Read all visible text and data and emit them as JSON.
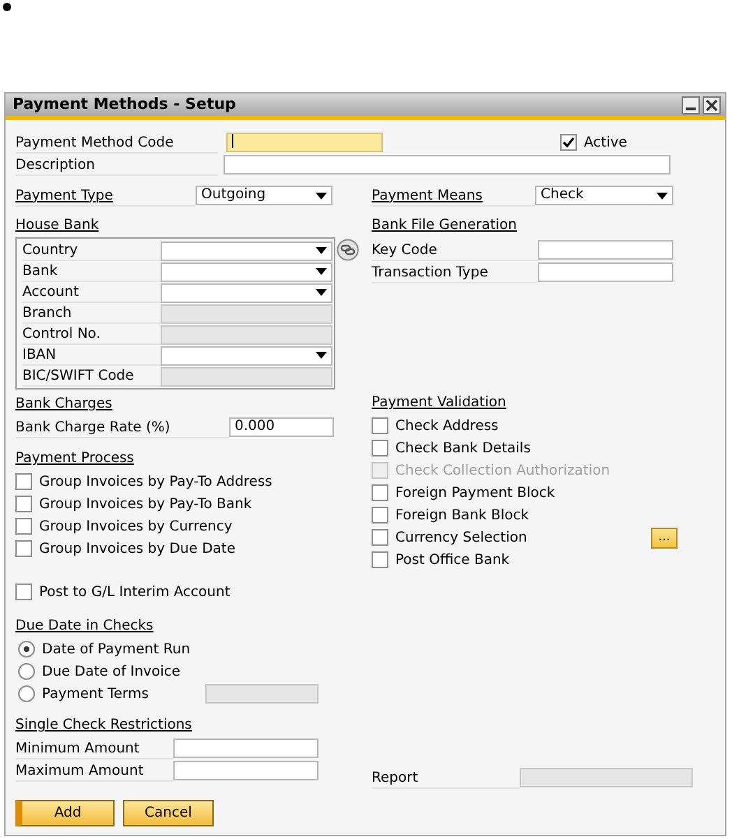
{
  "window": {
    "title": "Payment Methods - Setup"
  },
  "header_fields": [
    {
      "label": "Payment Method Code",
      "focused": true
    },
    {
      "label": "Description",
      "focused": false
    }
  ],
  "active": {
    "label": "Active",
    "checked": true
  },
  "payment_type": {
    "label": "Payment Type",
    "value": "Outgoing"
  },
  "payment_means": {
    "label": "Payment Means",
    "value": "Check"
  },
  "house_bank": {
    "title": "House Bank",
    "fields": [
      {
        "label": "Country",
        "kind": "dropdown"
      },
      {
        "label": "Bank",
        "kind": "dropdown"
      },
      {
        "label": "Account",
        "kind": "dropdown"
      },
      {
        "label": "Branch",
        "kind": "readonly"
      },
      {
        "label": "Control No.",
        "kind": "readonly"
      },
      {
        "label": "IBAN",
        "kind": "dropdown"
      },
      {
        "label": "BIC/SWIFT Code",
        "kind": "readonly"
      }
    ]
  },
  "bank_file_generation": {
    "title": "Bank File Generation",
    "fields": [
      {
        "label": "Key Code"
      },
      {
        "label": "Transaction Type"
      }
    ]
  },
  "bank_charges": {
    "title": "Bank Charges",
    "label": "Bank Charge Rate (%)",
    "value": "0.000"
  },
  "payment_process": {
    "title": "Payment Process",
    "options": [
      {
        "label": "Group Invoices by Pay-To Address",
        "checked": false
      },
      {
        "label": "Group Invoices by Pay-To Bank",
        "checked": false
      },
      {
        "label": "Group Invoices by Currency",
        "checked": false
      },
      {
        "label": "Group Invoices by Due Date",
        "checked": false
      }
    ],
    "interim": {
      "label": "Post to G/L Interim Account",
      "checked": false
    }
  },
  "due_date_in_checks": {
    "title": "Due Date in Checks",
    "options": [
      {
        "label": "Date of Payment Run",
        "selected": true,
        "with_field": false
      },
      {
        "label": "Due Date of Invoice",
        "selected": false,
        "with_field": false
      },
      {
        "label": "Payment Terms",
        "selected": false,
        "with_field": true
      }
    ]
  },
  "single_check_restrictions": {
    "title": "Single Check Restrictions",
    "fields": [
      {
        "label": "Minimum Amount"
      },
      {
        "label": "Maximum Amount"
      }
    ]
  },
  "payment_validation": {
    "title": "Payment Validation",
    "options": [
      {
        "label": "Check Address",
        "checked": false,
        "disabled": false
      },
      {
        "label": "Check Bank Details",
        "checked": false,
        "disabled": false
      },
      {
        "label": "Check Collection Authorization",
        "checked": false,
        "disabled": true
      },
      {
        "label": "Foreign Payment Block",
        "checked": false,
        "disabled": false
      },
      {
        "label": "Foreign Bank Block",
        "checked": false,
        "disabled": false
      },
      {
        "label": "Currency Selection",
        "checked": false,
        "disabled": false,
        "button": "..."
      },
      {
        "label": "Post Office Bank",
        "checked": false,
        "disabled": false
      }
    ]
  },
  "report": {
    "label": "Report"
  },
  "buttons": [
    {
      "label": "Add",
      "default": true
    },
    {
      "label": "Cancel",
      "default": false
    }
  ]
}
